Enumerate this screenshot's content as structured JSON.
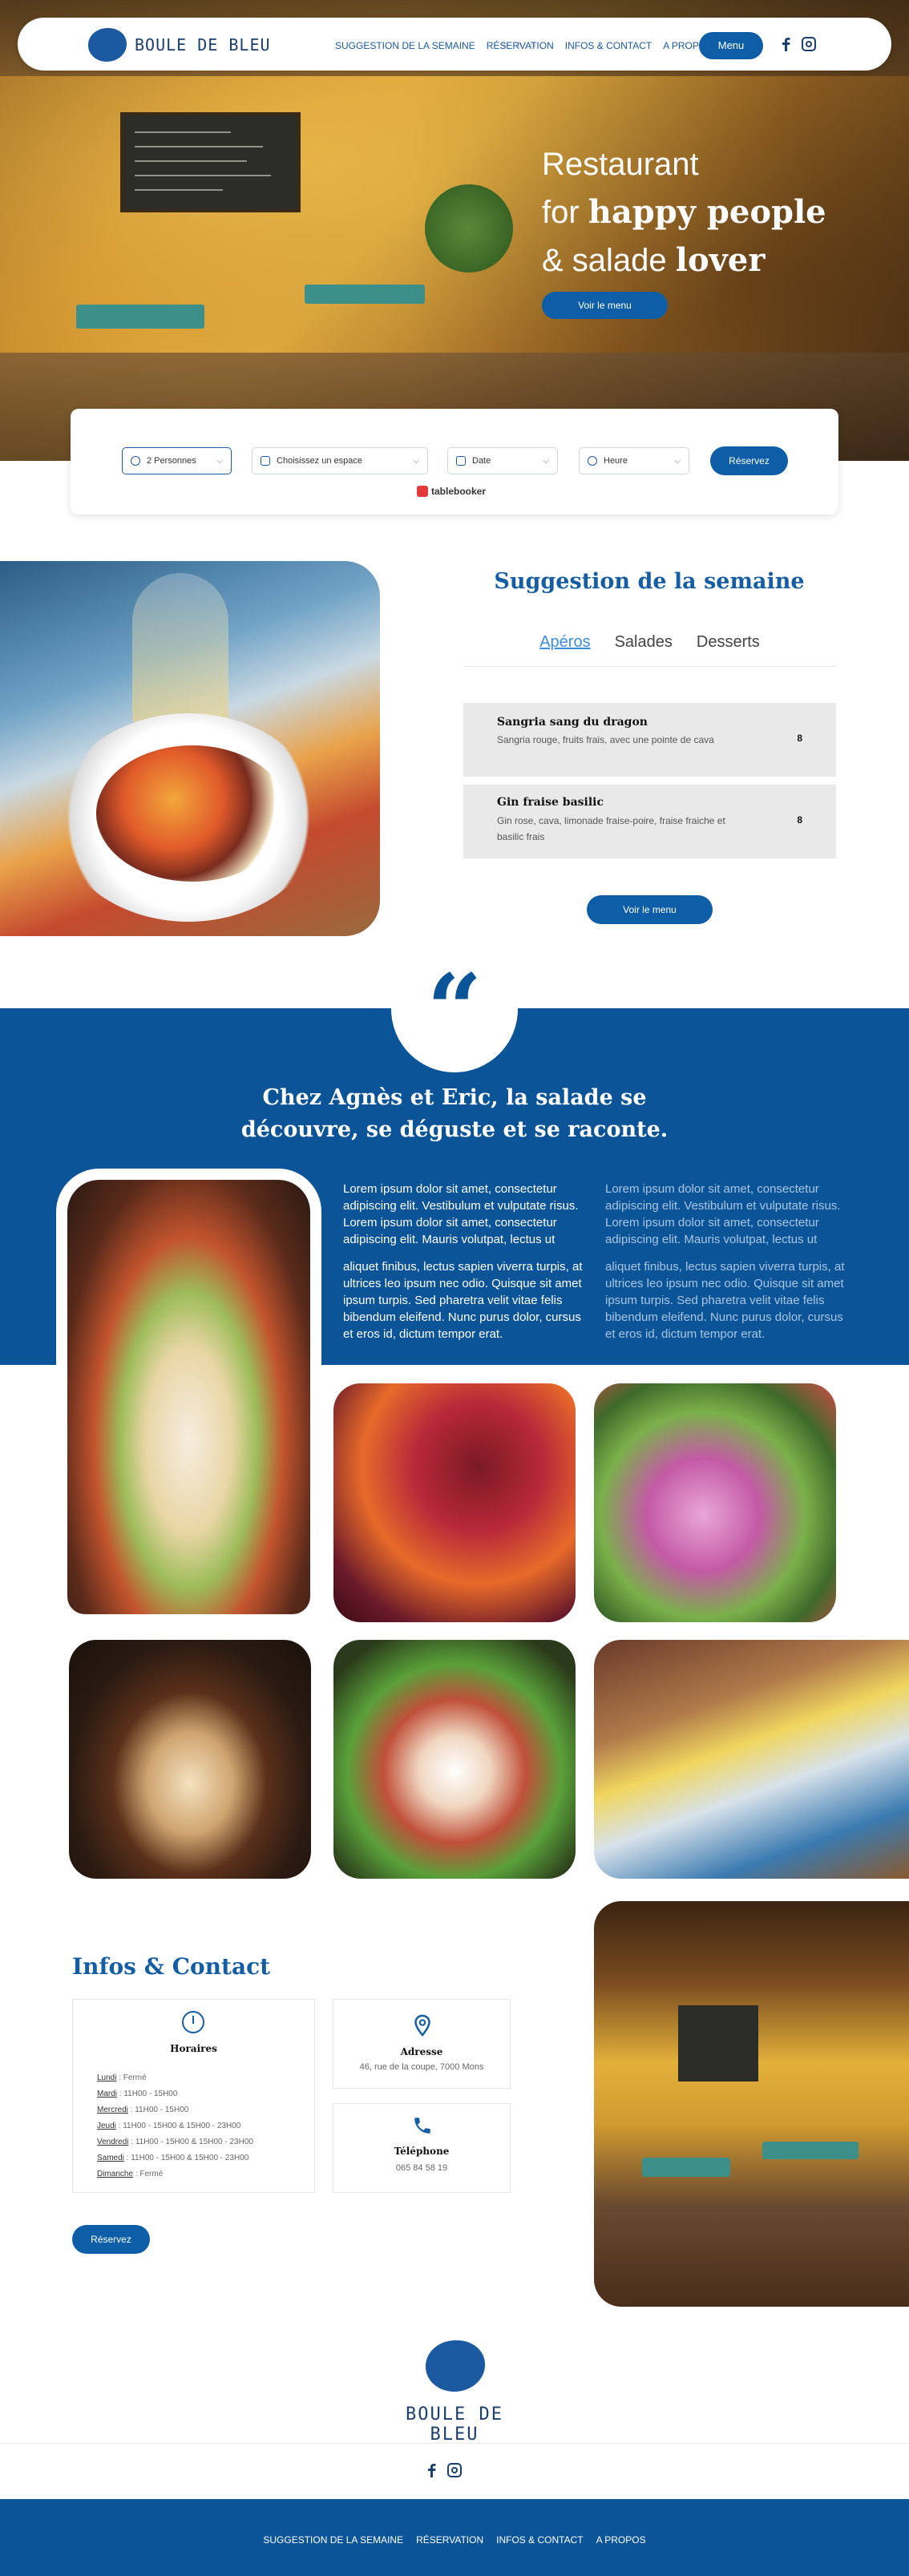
{
  "colors": {
    "primary": "#0b5497",
    "accent": "#0d5ea6",
    "title": "#155ea3"
  },
  "nav": {
    "logo": "BOULE DE BLEU",
    "links": [
      "SUGGESTION DE LA SEMAINE",
      "RÉSERVATION",
      "INFOS & CONTACT",
      "A PROPOS"
    ],
    "menu_label": "Menu",
    "social": [
      "facebook-icon",
      "instagram-icon"
    ]
  },
  "hero": {
    "line1": "Restaurant",
    "line2_light": "for ",
    "line2_bold": "happy people",
    "line3_light": "& salade ",
    "line3_bold": "lover",
    "button": "Voir le menu"
  },
  "booking": {
    "persons": "2 Personnes",
    "space": "Choisissez un espace",
    "date": "Date",
    "time": "Heure",
    "button": "Réservez",
    "brand": "tablebooker"
  },
  "suggestion": {
    "title": "Suggestion de la semaine",
    "tabs": [
      "Apéros",
      "Salades",
      "Desserts"
    ],
    "items": [
      {
        "name": "Sangria sang du dragon",
        "desc": "Sangria rouge, fruits frais, avec une pointe de cava",
        "price": "8"
      },
      {
        "name": "Gin fraise basilic",
        "desc": "Gin rose, cava, limonade fraise-poire, fraise fraiche et basilic frais",
        "price": "8"
      }
    ],
    "button": "Voir le menu"
  },
  "about": {
    "quote_mark": "“",
    "title_line1": "Chez Agnès et Eric, la salade se",
    "title_line2": "découvre, se déguste et se raconte.",
    "p1": "Lorem ipsum dolor sit amet, consectetur adipiscing elit. Vestibulum et vulputate risus. Lorem ipsum dolor sit amet, consectetur adipiscing elit. Mauris volutpat, lectus ut",
    "p2": "aliquet finibus, lectus sapien viverra turpis, at ultrices leo ipsum nec odio. Quisque sit amet ipsum turpis. Sed pharetra velit vitae felis bibendum eleifend. Nunc purus dolor, cursus et eros id, dictum tempor erat."
  },
  "infos": {
    "title": "Infos & Contact",
    "hours_title": "Horaires",
    "hours": [
      {
        "day": "Lundi",
        "value": " : Fermé"
      },
      {
        "day": "Mardi",
        "value": " : 11H00 - 15H00"
      },
      {
        "day": "Mercredi",
        "value": " : 11H00 - 15H00"
      },
      {
        "day": "Jeudi",
        "value": " : 11H00 - 15H00 & 15H00 - 23H00"
      },
      {
        "day": "Vendredi",
        "value": " : 11H00 - 15H00 & 15H00 - 23H00"
      },
      {
        "day": "Samedi",
        "value": " : 11H00 - 15H00 & 15H00 - 23H00"
      },
      {
        "day": "Dimanche",
        "value": " : Fermé"
      }
    ],
    "address_title": "Adresse",
    "address": "46, rue de la coupe, 7000 Mons",
    "phone_title": "Téléphone",
    "phone": "065 84 58 19",
    "button": "Réservez"
  },
  "footer": {
    "logo": "BOULE DE BLEU",
    "links": [
      "SUGGESTION DE LA SEMAINE",
      "RÉSERVATION",
      "INFOS & CONTACT",
      "A PROPOS"
    ]
  }
}
